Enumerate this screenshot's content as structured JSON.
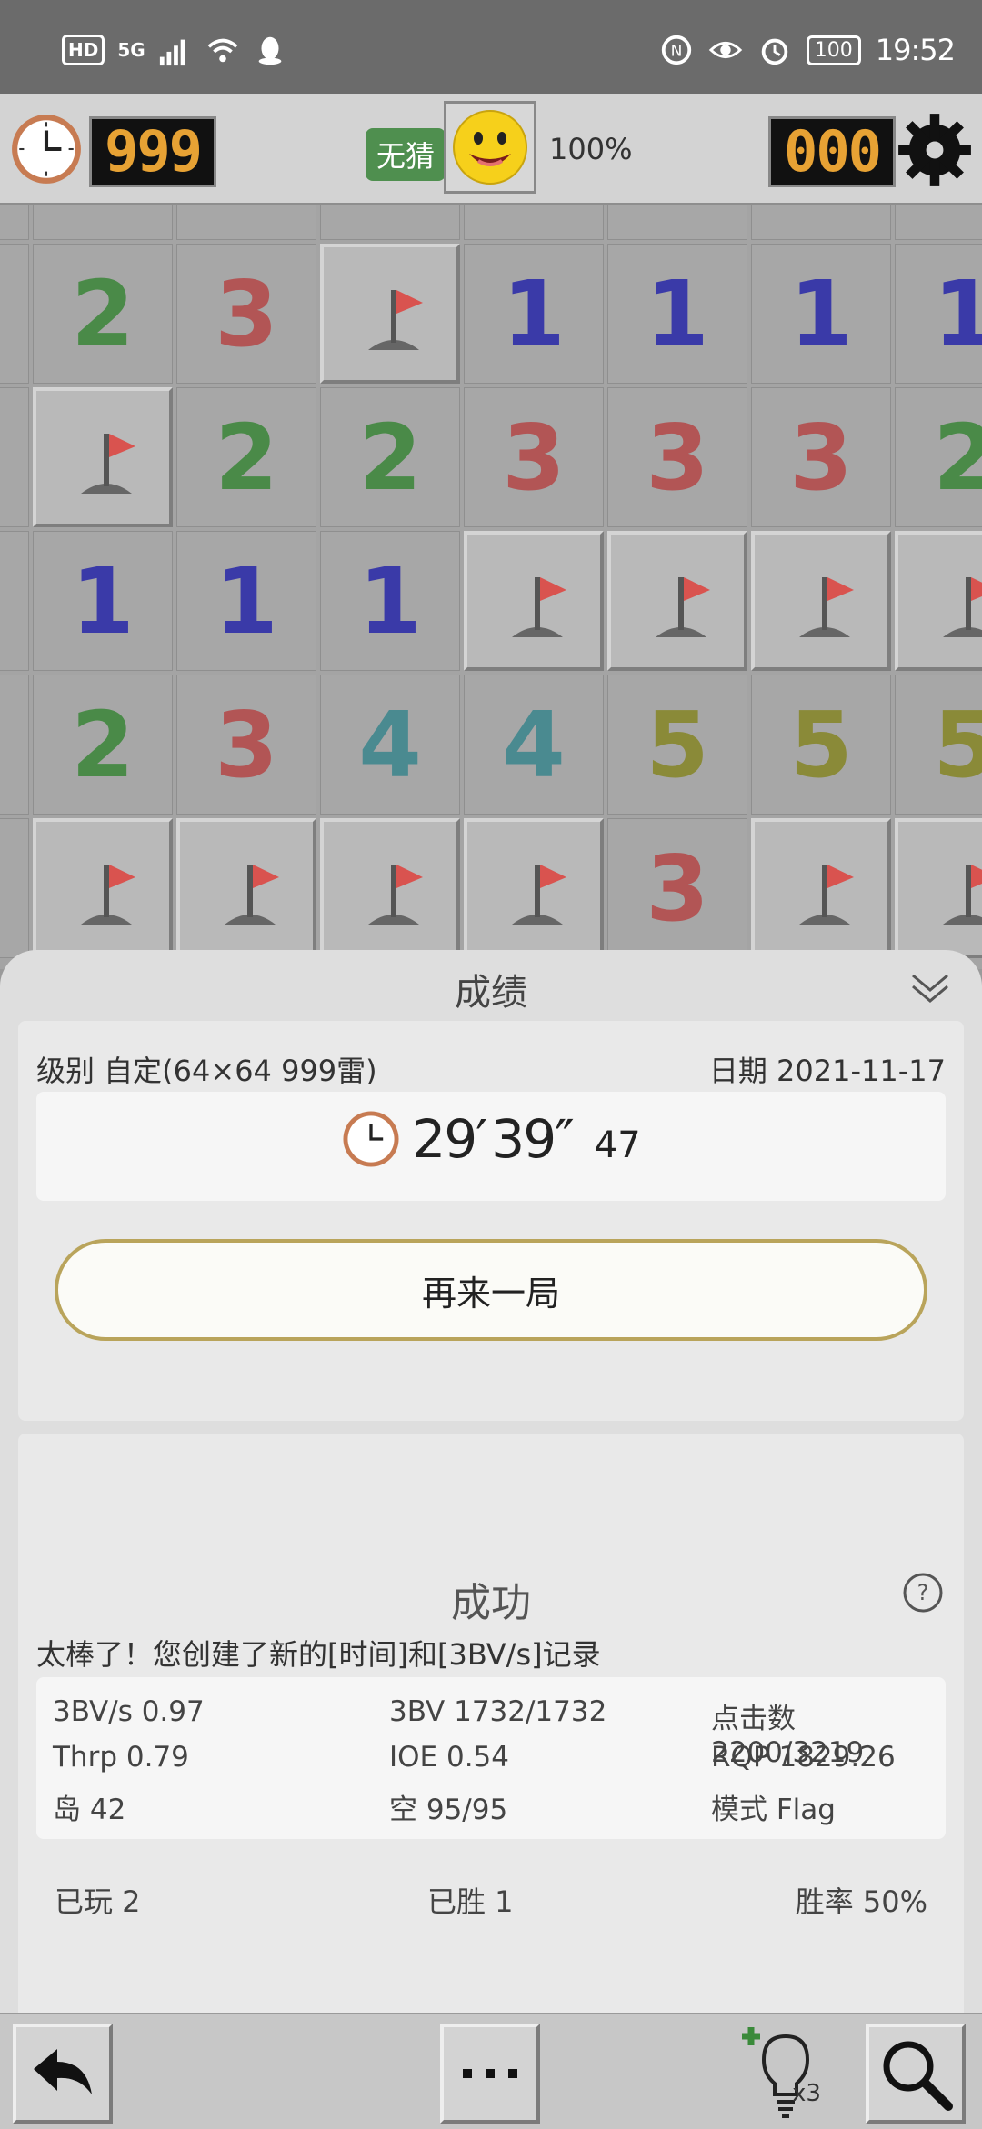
{
  "status_bar": {
    "hd": "HD",
    "network": "5G",
    "battery": "100",
    "time": "19:52"
  },
  "header": {
    "timer": "999",
    "no_guess": "无猜",
    "progress": "100%",
    "mine_counter": "000"
  },
  "board": {
    "rows": [
      [
        {
          "v": "2"
        },
        {
          "v": "3"
        },
        {
          "v": "F"
        },
        {
          "v": "1"
        },
        {
          "v": "1"
        },
        {
          "v": "1"
        },
        {
          "v": "1"
        }
      ],
      [
        {
          "v": "F"
        },
        {
          "v": "2"
        },
        {
          "v": "2"
        },
        {
          "v": "3"
        },
        {
          "v": "3"
        },
        {
          "v": "3"
        },
        {
          "v": "2"
        }
      ],
      [
        {
          "v": "1"
        },
        {
          "v": "1"
        },
        {
          "v": "1"
        },
        {
          "v": "F"
        },
        {
          "v": "F"
        },
        {
          "v": "F"
        },
        {
          "v": "F"
        }
      ],
      [
        {
          "v": "2"
        },
        {
          "v": "3"
        },
        {
          "v": "4"
        },
        {
          "v": "4"
        },
        {
          "v": "5"
        },
        {
          "v": "5"
        },
        {
          "v": "5"
        }
      ],
      [
        {
          "v": "F"
        },
        {
          "v": "F"
        },
        {
          "v": "F"
        },
        {
          "v": "F"
        },
        {
          "v": "3"
        },
        {
          "v": "F"
        },
        {
          "v": "F"
        }
      ]
    ],
    "number_colors": {
      "1": "#3a3aa8",
      "2": "#4a8a48",
      "3": "#b25555",
      "4": "#4a8a90",
      "5": "#8a8a38"
    }
  },
  "result": {
    "title": "成绩",
    "level": "级别 自定(64×64  999雷)",
    "date": "日期 2021-11-17",
    "time_minutes": "29′",
    "time_seconds": "39″",
    "time_hundredths": "47",
    "play_again": "再来一局",
    "success_title": "成功",
    "record_message": "太棒了！您创建了新的[时间]和[3BV/s]记录",
    "stats": [
      [
        "3BV/s 0.97",
        "3BV 1732/1732",
        "点击数 2200/3219"
      ],
      [
        "Thrp 0.79",
        "IOE 0.54",
        "RQP 1829.26"
      ],
      [
        "岛 42",
        "空 95/95",
        "模式 Flag"
      ]
    ],
    "played": "已玩 2",
    "won": "已胜 1",
    "win_rate": "胜率 50%"
  },
  "toolbar": {
    "hint_count": "x3"
  }
}
